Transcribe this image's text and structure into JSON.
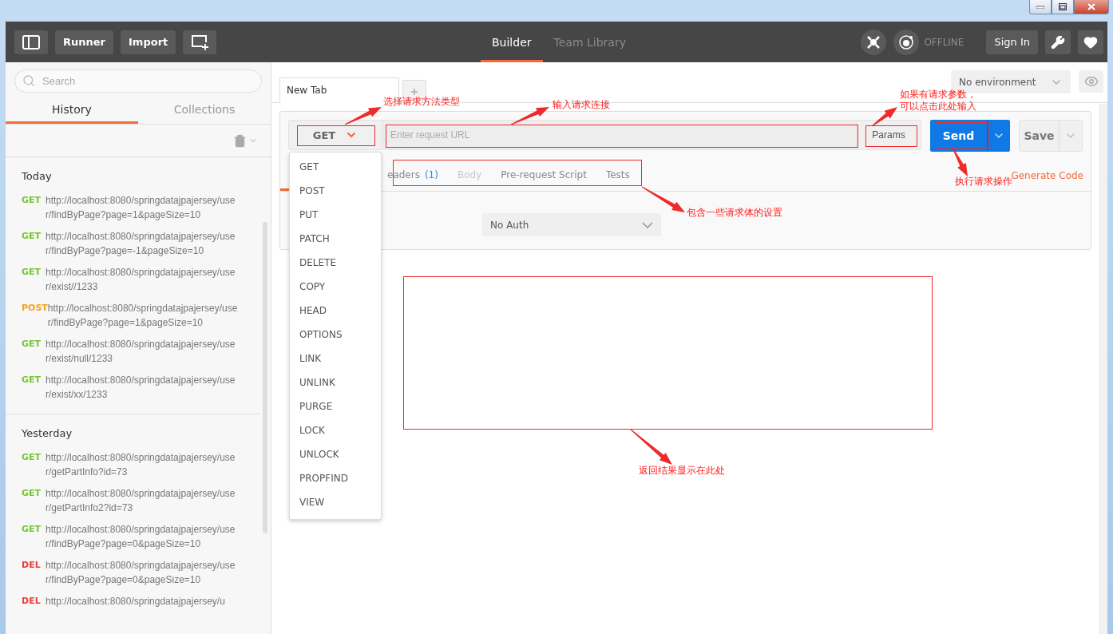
{
  "header": {
    "buttons": [
      "Runner",
      "Import"
    ],
    "tabs": [
      {
        "label": "Builder",
        "selected": true
      },
      {
        "label": "Team Library",
        "selected": false
      }
    ],
    "status": "OFFLINE",
    "sign_in": "Sign In"
  },
  "sidebar": {
    "search": {
      "placeholder": "Search"
    },
    "tabs": [
      {
        "label": "History",
        "selected": true
      },
      {
        "label": "Collections",
        "selected": false
      }
    ],
    "groups": [
      {
        "title": "Today",
        "items": [
          {
            "method": "GET",
            "color": "#74c72d",
            "url": "http://localhost:8080/springdatajpajersey/user/findByPage?page=1&pageSize=10"
          },
          {
            "method": "GET",
            "color": "#74c72d",
            "url": "http://localhost:8080/springdatajpajersey/user/findByPage?page=-1&pageSize=10"
          },
          {
            "method": "GET",
            "color": "#74c72d",
            "url": "http://localhost:8080/springdatajpajersey/user/exist//1233"
          },
          {
            "method": "POST",
            "color": "#f5a31b",
            "url": "http://localhost:8080/springdatajpajersey/user/findByPage?page=1&pageSize=10"
          },
          {
            "method": "GET",
            "color": "#74c72d",
            "url": "http://localhost:8080/springdatajpajersey/user/exist/null/1233"
          },
          {
            "method": "GET",
            "color": "#74c72d",
            "url": "http://localhost:8080/springdatajpajersey/user/exist/xx/1233"
          }
        ]
      },
      {
        "title": "Yesterday",
        "items": [
          {
            "method": "GET",
            "color": "#74c72d",
            "url": "http://localhost:8080/springdatajpajersey/user/getPartInfo?id=73"
          },
          {
            "method": "GET",
            "color": "#74c72d",
            "url": "http://localhost:8080/springdatajpajersey/user/getPartInfo2?id=73"
          },
          {
            "method": "GET",
            "color": "#74c72d",
            "url": "http://localhost:8080/springdatajpajersey/user/findByPage?page=0&pageSize=10"
          },
          {
            "method": "DEL",
            "color": "#ed3b3b",
            "url": "http://localhost:8080/springdatajpajersey/user/findByPage?page=0&pageSize=10"
          },
          {
            "method": "DEL",
            "color": "#ed3b3b",
            "url": "http://localhost:8080/springdatajpajersey/u"
          }
        ]
      }
    ]
  },
  "request_tabs": [
    {
      "label": "New Tab",
      "selected": true
    }
  ],
  "environment": {
    "value": "No environment"
  },
  "request": {
    "method": "GET",
    "url": {
      "placeholder": "Enter request URL"
    },
    "params": "Params",
    "send": "Send",
    "save": "Save"
  },
  "subtabs": [
    {
      "label": "eaders",
      "count": "(1)",
      "disabled": false
    },
    {
      "label": "Body",
      "disabled": true
    },
    {
      "label": "Pre-request Script",
      "disabled": false
    },
    {
      "label": "Tests",
      "disabled": false
    }
  ],
  "generate_code": "Generate Code",
  "auth": {
    "value": "No Auth"
  },
  "method_menu": {
    "items": [
      "GET",
      "POST",
      "PUT",
      "PATCH",
      "DELETE",
      "COPY",
      "HEAD",
      "OPTIONS",
      "LINK",
      "UNLINK",
      "PURGE",
      "LOCK",
      "UNLOCK",
      "PROPFIND",
      "VIEW"
    ]
  },
  "annotations": [
    {
      "label": "选择请求方法类型"
    },
    {
      "label": "输入请求连接"
    },
    {
      "label": "如果有请求参数，可以点击此处输入"
    },
    {
      "label": "执行请求操作"
    },
    {
      "label": "包含一些请求体的设置"
    },
    {
      "label": "返回结果显示在此处"
    }
  ]
}
